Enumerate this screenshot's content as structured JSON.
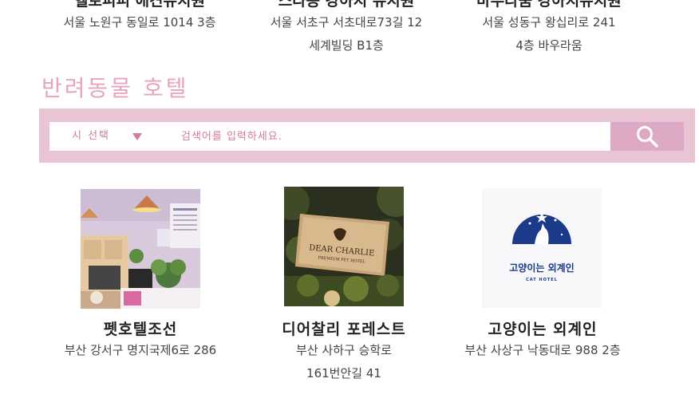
{
  "top_cards": [
    {
      "name": "헬로피피 애견유치원",
      "address_lines": [
        "서울 노원구 동일로 1014 3층"
      ]
    },
    {
      "name": "스타송 강아지 유치원",
      "address_lines": [
        "서울 서초구 서초대로73길 12",
        "세계빌딩 B1층"
      ]
    },
    {
      "name": "바우라움 강아지유치원",
      "address_lines": [
        "서울 성동구 왕십리로 241",
        "4층 바우라움"
      ]
    }
  ],
  "section": {
    "title": "반려동물 호텔"
  },
  "search": {
    "select_label": "시 선택",
    "placeholder": "검색어를 입력하세요.",
    "icon": "search-icon"
  },
  "hotels": [
    {
      "name": "펫호텔조선",
      "address_lines": [
        "부산 강서구 명지국제6로 286"
      ],
      "image": "pet-hotel-interior-photo"
    },
    {
      "name": "디어찰리 포레스트",
      "address_lines": [
        "부산 사하구 승학로",
        "161번안길 41"
      ],
      "image": "dear-charlie-sign-photo",
      "sign_lines": [
        "DEAR CHARLIE",
        "PREMIUM PET HOTEL"
      ]
    },
    {
      "name": "고양이는 외계인",
      "address_lines": [
        "부산 사상구 낙동대로 988 2층"
      ],
      "image": "cat-hotel-logo",
      "logo_lines": [
        "고양이는 외계인",
        "CAT HOTEL"
      ]
    }
  ],
  "colors": {
    "accent": "#e7a3bf",
    "band": "#e9c4d5",
    "button": "#dea9c4",
    "select_text": "#d47aa0"
  }
}
